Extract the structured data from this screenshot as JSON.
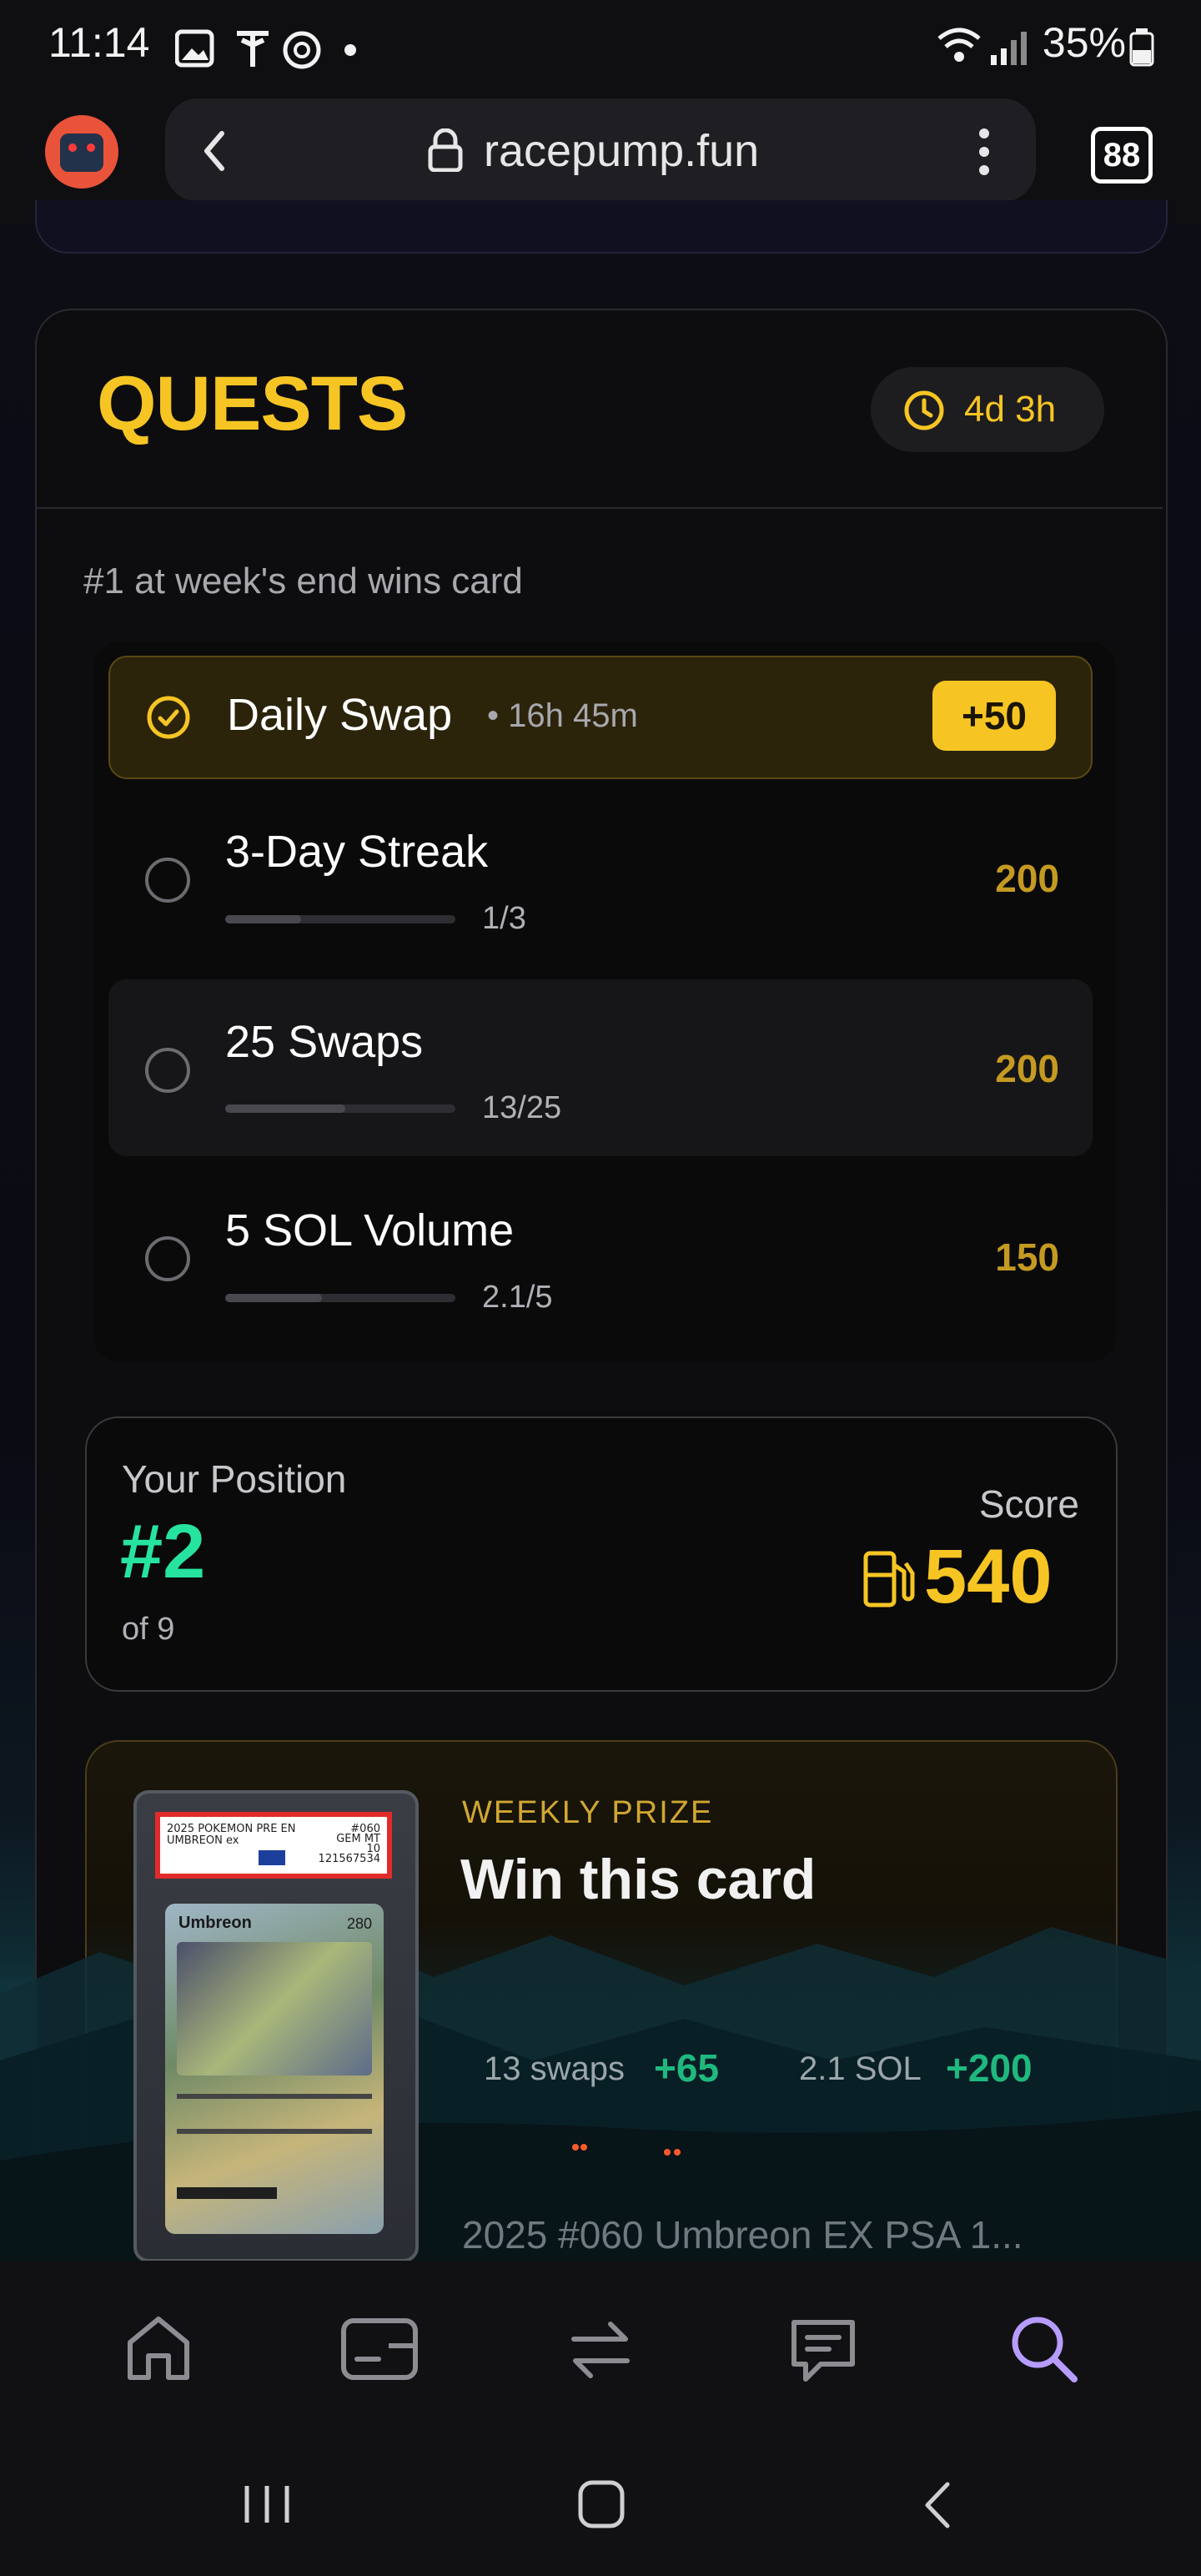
{
  "status_bar": {
    "time": "11:14",
    "battery": "35%"
  },
  "browser": {
    "url": "racepump.fun",
    "tab_count": "88"
  },
  "quests": {
    "title": "QUESTS",
    "timer": "4d 3h",
    "subtitle": "#1 at week's end wins card",
    "items": [
      {
        "title": "Daily Swap",
        "meta": "• 16h 45m",
        "points": "+50",
        "completed": true
      },
      {
        "title": "3-Day Streak",
        "progress_text": "1/3",
        "progress": 0.33,
        "points": "200",
        "completed": false
      },
      {
        "title": "25 Swaps",
        "progress_text": "13/25",
        "progress": 0.52,
        "points": "200",
        "completed": false
      },
      {
        "title": "5 SOL Volume",
        "progress_text": "2.1/5",
        "progress": 0.42,
        "points": "150",
        "completed": false
      }
    ]
  },
  "position": {
    "label": "Your Position",
    "rank": "#2",
    "of": "of 9",
    "score_label": "Score",
    "score": "540"
  },
  "prize": {
    "eyebrow": "WEEKLY PRIZE",
    "title": "Win this card",
    "stats": [
      {
        "label": "13 swaps",
        "value": "+65"
      },
      {
        "label": "2.1 SOL",
        "value": "+200"
      }
    ],
    "card_name": "2025 #060 Umbreon EX PSA 1...",
    "slab_label_line1": "2025 POKEMON PRE EN",
    "slab_label_line2": "UMBREON ex",
    "slab_grade_line1": "#060",
    "slab_grade_line2": "GEM MT",
    "slab_grade_line3": "10",
    "slab_cert": "121567534",
    "card_inner_name": "Umbreon",
    "card_hp": "280"
  },
  "colors": {
    "accent_yellow": "#f6c524",
    "green": "#27e3a0",
    "muted_gold": "#c59a22",
    "nav_active": "#b79cff"
  },
  "nav": {
    "items": [
      "home-icon",
      "wallet-icon",
      "swap-icon",
      "chat-icon",
      "search-icon"
    ],
    "active": "search-icon"
  }
}
